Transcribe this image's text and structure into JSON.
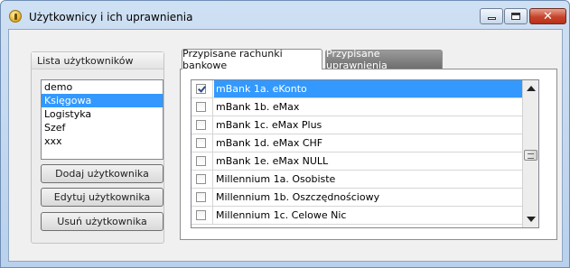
{
  "window": {
    "title": "Użytkownicy i ich uprawnienia",
    "controls": {
      "minimize": "minimize",
      "maximize": "maximize",
      "close": "✕"
    }
  },
  "users_group": {
    "title": "Lista użytkowników",
    "users": [
      "demo",
      "Księgowa",
      "Logistyka",
      "Szef",
      "xxx"
    ],
    "selected_user": "Księgowa",
    "buttons": {
      "add": "Dodaj użytkownika",
      "edit": "Edytuj użytkownika",
      "delete": "Usuń użytkownika"
    }
  },
  "tabs": [
    {
      "label": "Przypisane rachunki bankowe",
      "active": true
    },
    {
      "label": "Przypisane uprawnienia",
      "active": false
    }
  ],
  "accounts": [
    {
      "name": "mBank 1a. eKonto",
      "checked": true,
      "selected": true
    },
    {
      "name": "mBank 1b. eMax",
      "checked": false,
      "selected": false
    },
    {
      "name": "mBank 1c. eMax Plus",
      "checked": false,
      "selected": false
    },
    {
      "name": "mBank 1d. eMax CHF",
      "checked": false,
      "selected": false
    },
    {
      "name": "mBank 1e. eMax NULL",
      "checked": false,
      "selected": false
    },
    {
      "name": "Millennium 1a. Osobiste",
      "checked": false,
      "selected": false
    },
    {
      "name": "Millennium 1b. Oszczędnościowy",
      "checked": false,
      "selected": false
    },
    {
      "name": "Millennium 1c. Celowe Nic",
      "checked": false,
      "selected": false
    }
  ],
  "colors": {
    "selection": "#3399ff",
    "title_bar": "#c4d8ef",
    "close_button": "#c6442c"
  },
  "icons": {
    "app": "coin-icon",
    "scroll_up": "arrow-up-icon",
    "scroll_down": "arrow-down-icon"
  }
}
